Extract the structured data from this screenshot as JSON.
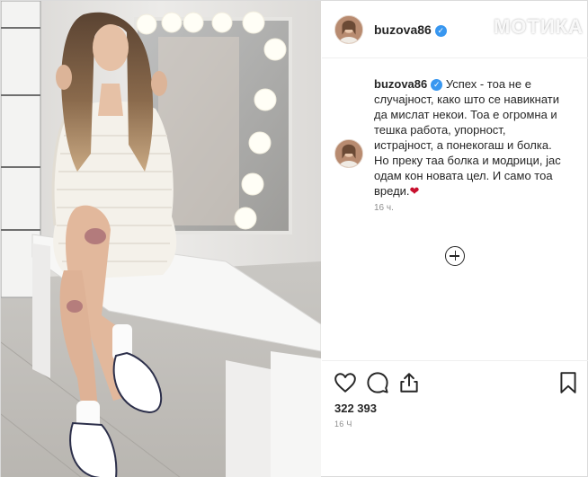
{
  "watermark": "МОТИКА",
  "header": {
    "username": "buzova86",
    "verified": true,
    "verified_icon": "verified-badge-icon"
  },
  "caption": {
    "username": "buzova86",
    "text": "Успех - тоа не е случајност, како што се навикнати да мислат некои. Тоа е огромна и тешка работа, упорност, истрајност, а понекогаш и болка. Но преку таа болка и модрици, јас одам кон новата цел. И само тоа вреди.",
    "emoji": "❤",
    "time": "16 ч."
  },
  "actions": {
    "icons": [
      "heart-icon",
      "comment-icon",
      "share-icon",
      "bookmark-icon"
    ],
    "likes": "322 393",
    "time": "16 Ч"
  },
  "colors": {
    "verified": "#3897f0",
    "heart": "#c8102e",
    "text": "#262626",
    "muted": "#8e8e8e"
  }
}
